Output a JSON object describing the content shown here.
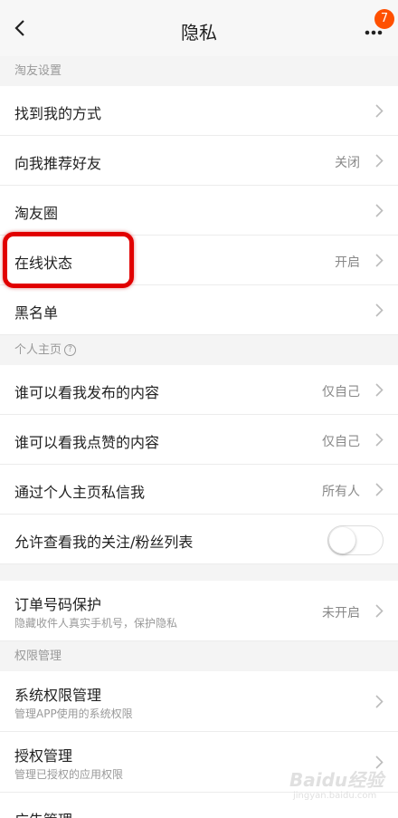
{
  "nav": {
    "title": "隐私",
    "badge": "7"
  },
  "sections": {
    "friend_settings": "淘友设置",
    "homepage": "个人主页",
    "permissions": "权限管理"
  },
  "rows": {
    "find_me": {
      "label": "找到我的方式"
    },
    "recommend": {
      "label": "向我推荐好友",
      "value": "关闭"
    },
    "circle": {
      "label": "淘友圈"
    },
    "online": {
      "label": "在线状态",
      "value": "开启"
    },
    "blacklist": {
      "label": "黑名单"
    },
    "who_posts": {
      "label": "谁可以看我发布的内容",
      "value": "仅自己"
    },
    "who_likes": {
      "label": "谁可以看我点赞的内容",
      "value": "仅自己"
    },
    "dm": {
      "label": "通过个人主页私信我",
      "value": "所有人"
    },
    "follow_list": {
      "label": "允许查看我的关注/粉丝列表",
      "toggle_on": false
    },
    "order_phone": {
      "label": "订单号码保护",
      "sub": "隐藏收件人真实手机号，保护隐私",
      "value": "未开启"
    },
    "sys_perm": {
      "label": "系统权限管理",
      "sub": "管理APP使用的系统权限"
    },
    "auth": {
      "label": "授权管理",
      "sub": "管理已授权的应用权限"
    },
    "ads": {
      "label": "广告管理"
    }
  },
  "watermark": {
    "text": "Baidu经验",
    "sub": "jingyan.baidu.com"
  },
  "colors": {
    "accent": "#ff5000",
    "highlight": "#e10000"
  }
}
